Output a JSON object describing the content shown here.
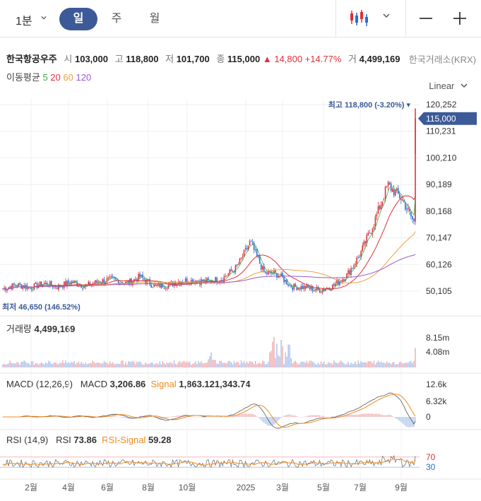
{
  "toolbar": {
    "interval": "1분",
    "tabs": [
      {
        "label": "일",
        "active": true
      },
      {
        "label": "주",
        "active": false
      },
      {
        "label": "월",
        "active": false
      }
    ],
    "chart_type_icon": "candlestick-icon",
    "zoom_out_icon": "minus-icon",
    "zoom_in_icon": "plus-icon",
    "accent_color": "#3d5a98"
  },
  "quote": {
    "name": "한국항공우주",
    "open_label": "시",
    "open": "103,000",
    "high_label": "고",
    "high": "118,800",
    "low_label": "저",
    "low": "101,700",
    "close_label": "종",
    "close": "115,000",
    "change": "14,800",
    "change_pct": "+14.77%",
    "volume_label": "거",
    "volume": "4,499,169",
    "exchange": "한국거래소(KRX)",
    "up_color": "#e0303a",
    "down_color": "#2a6fd6"
  },
  "moving_average": {
    "label": "이동평균",
    "periods": [
      "5",
      "20",
      "60",
      "120"
    ],
    "colors": {
      "5": "#3fae49",
      "20": "#e0303a",
      "60": "#f0a040",
      "120": "#9b59d0"
    }
  },
  "scale_type": "Linear",
  "price_panel": {
    "max_annotation": "최고",
    "max_value": "118,800 (-3.20%)",
    "min_annotation": "최저",
    "min_value": "46,650 (146.52%)",
    "current_price_tag": "115,000",
    "y_ticks": [
      "120,252",
      "110,231",
      "100,210",
      "90,189",
      "80,168",
      "70,147",
      "60,126",
      "50,105"
    ]
  },
  "volume_panel": {
    "label": "거래량",
    "value": "4,499,169",
    "y_ticks": [
      "8.15m",
      "4.08m"
    ]
  },
  "macd_panel": {
    "label": "MACD (12,26,9)",
    "macd_label": "MACD",
    "macd_value": "3,206.86",
    "signal_label": "Signal",
    "signal_value": "1,863.121,343.74",
    "y_ticks": [
      "12.6k",
      "6.32k",
      "0"
    ]
  },
  "rsi_panel": {
    "label": "RSI (14,9)",
    "rsi_label": "RSI",
    "rsi_value": "73.86",
    "signal_label": "RSI-Signal",
    "signal_value": "59.28",
    "y_ticks": [
      "70",
      "30"
    ]
  },
  "x_axis": {
    "ticks": [
      "2월",
      "4월",
      "6월",
      "8월",
      "10월",
      "2025",
      "3월",
      "5월",
      "7월",
      "9월"
    ]
  },
  "chart_data": {
    "type": "line",
    "title": "",
    "xlabel": "",
    "ylabel": "",
    "x_ticks": [
      "2월",
      "4월",
      "6월",
      "8월",
      "10월",
      "2025",
      "3월",
      "5월",
      "7월",
      "9월"
    ],
    "ylim": [
      46650,
      122000
    ],
    "series": [
      {
        "name": "종",
        "x": [
          0,
          20,
          40,
          60,
          80,
          100,
          120,
          140,
          160,
          180,
          200,
          220,
          240,
          260,
          280,
          300,
          320,
          340,
          360,
          380,
          400,
          420,
          440,
          460,
          480,
          500,
          520,
          540,
          560,
          580,
          600
        ],
        "values": [
          51000,
          52500,
          51500,
          53000,
          51800,
          53500,
          52000,
          53800,
          54500,
          53000,
          55500,
          52000,
          52500,
          54000,
          54000,
          53800,
          55000,
          59000,
          68500,
          57000,
          56500,
          51800,
          51500,
          50500,
          52000,
          56000,
          64000,
          76000,
          90000,
          85000,
          75000
        ]
      }
    ],
    "volume_ylim": [
      0,
      8150000
    ],
    "macd_ylim": [
      -3000,
      12600
    ],
    "rsi_levels": [
      70,
      30
    ]
  }
}
